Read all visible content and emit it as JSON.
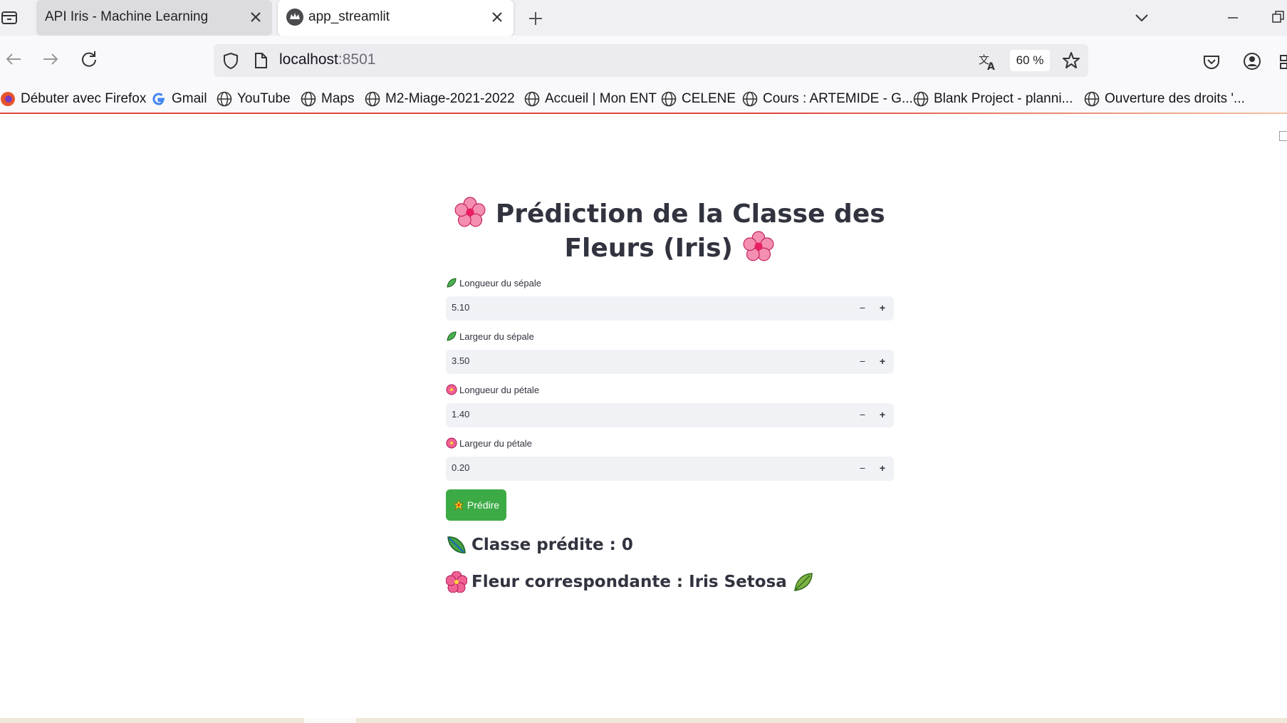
{
  "browser": {
    "tabs": [
      {
        "title": "API Iris - Machine Learning",
        "active": false
      },
      {
        "title": "app_streamlit",
        "active": true
      }
    ],
    "url_host": "localhost",
    "url_port": ":8501",
    "zoom": "60 %",
    "bookmarks": [
      {
        "label": "Débuter avec Firefox",
        "icon": "firefox-icon"
      },
      {
        "label": "Gmail",
        "icon": "google-icon"
      },
      {
        "label": "YouTube",
        "icon": "globe-icon"
      },
      {
        "label": "Maps",
        "icon": "globe-icon"
      },
      {
        "label": "M2-Miage-2021-2022",
        "icon": "globe-icon"
      },
      {
        "label": "Accueil | Mon ENT",
        "icon": "globe-icon"
      },
      {
        "label": "CELENE",
        "icon": "globe-icon"
      },
      {
        "label": "Cours : ARTEMIDE - G...",
        "icon": "globe-icon"
      },
      {
        "label": "Blank Project - planni...",
        "icon": "globe-icon"
      },
      {
        "label": "Ouverture des droits '...",
        "icon": "globe-icon"
      }
    ]
  },
  "app": {
    "title": "Prédiction de la Classe des Fleurs (Iris)",
    "fields": [
      {
        "label": "Longueur du sépale",
        "value": "5.10",
        "icon": "leaf-icon"
      },
      {
        "label": "Largeur du sépale",
        "value": "3.50",
        "icon": "leaf-icon"
      },
      {
        "label": "Longueur du pétale",
        "value": "1.40",
        "icon": "hibiscus-icon"
      },
      {
        "label": "Largeur du pétale",
        "value": "0.20",
        "icon": "hibiscus-icon"
      }
    ],
    "stepper_minus": "−",
    "stepper_plus": "+",
    "predict_label": "Prédire",
    "result_class": "Classe prédite : 0",
    "result_flower": "Fleur correspondante : Iris Setosa"
  },
  "colors": {
    "accent_button": "#3cab46",
    "input_bg": "#f0f2f6",
    "text": "#31333f"
  }
}
